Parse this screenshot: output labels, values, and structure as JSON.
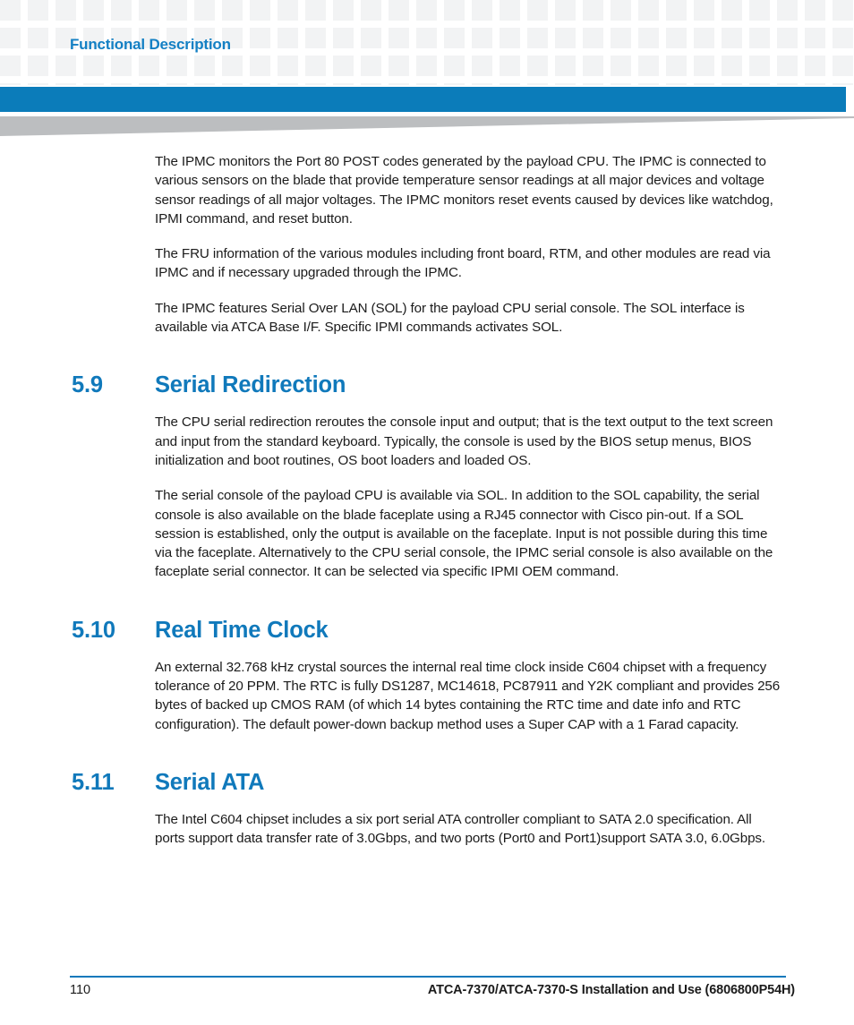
{
  "header": {
    "chapter_title": "Functional Description",
    "accent_color": "#0b7cba",
    "title_color": "#1480c4",
    "grid_color": "#f2f3f4",
    "wedge_color": "#bcbec0"
  },
  "content": {
    "intro_paragraphs": [
      "The IPMC monitors the Port 80 POST codes generated by the payload CPU. The IPMC is connected to various sensors on the blade that provide temperature sensor readings at all major devices and voltage sensor readings of all major voltages. The IPMC monitors reset events caused by devices like watchdog, IPMI command, and reset button.",
      "The FRU information of the various modules including front board, RTM, and other modules are read via IPMC and if necessary upgraded through the IPMC.",
      "The IPMC features Serial Over LAN (SOL) for the payload CPU serial console. The SOL interface is available via ATCA Base I/F. Specific IPMI commands activates SOL."
    ],
    "sections": [
      {
        "number": "5.9",
        "title": "Serial Redirection",
        "paragraphs": [
          "The CPU serial redirection reroutes the console input and output; that is the text output to the text screen and input from the standard keyboard. Typically, the console is used by the BIOS setup menus, BIOS initialization and boot routines, OS boot loaders and loaded OS.",
          "The serial console of the payload CPU is available via SOL. In addition to the SOL capability, the serial console is also available on the blade faceplate using a RJ45 connector with Cisco pin-out. If a SOL session is established, only the output is available on the faceplate. Input is not possible during this time via the faceplate. Alternatively to the CPU serial console, the IPMC serial console is also available on the faceplate serial connector. It can be selected via specific IPMI OEM command."
        ]
      },
      {
        "number": "5.10",
        "title": "Real Time Clock",
        "paragraphs": [
          "An external 32.768 kHz crystal sources the internal real time clock inside C604 chipset with a frequency tolerance of 20 PPM. The RTC is fully DS1287, MC14618, PC87911 and Y2K compliant and provides 256 bytes of backed up CMOS RAM (of which 14 bytes containing the RTC time and date info and RTC configuration). The default power-down backup method uses a Super CAP with a 1 Farad capacity."
        ]
      },
      {
        "number": "5.11",
        "title": "Serial ATA",
        "paragraphs": [
          "The Intel C604 chipset includes a six port serial ATA controller compliant to SATA 2.0 specification. All ports support data transfer rate of 3.0Gbps, and two ports (Port0 and Port1)support SATA 3.0, 6.0Gbps."
        ]
      }
    ]
  },
  "footer": {
    "page_number": "110",
    "document_title": "ATCA-7370/ATCA-7370-S Installation and Use (6806800P54H)",
    "rule_color": "#1079bb"
  }
}
